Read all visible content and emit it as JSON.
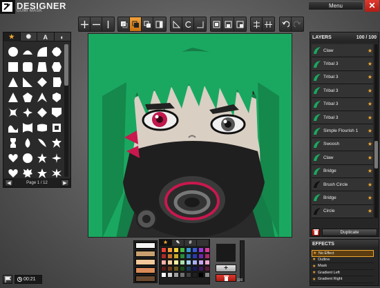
{
  "app": {
    "title": "DESIGNER",
    "subtitle": "GUMI MASK",
    "menu_label": "Menu",
    "close_label": "✕"
  },
  "toolbar": {
    "groups": [
      [
        "move-icon",
        "resize-horizontal-icon",
        "resize-vertical-icon"
      ],
      [
        "bring-front-icon",
        "stack-order-icon",
        "send-backward-icon",
        "send-back-icon"
      ],
      [
        "flip-horizontal-icon",
        "rotate-icon",
        "flip-vertical-icon"
      ],
      [
        "align-left-icon",
        "align-center-icon",
        "align-right-icon"
      ],
      [
        "center-horizontal-icon",
        "center-vertical-icon"
      ],
      [
        "undo-icon",
        "redo-icon"
      ]
    ]
  },
  "shapes": {
    "tabs": [
      "★",
      "✺",
      "A",
      "◐"
    ],
    "page_label": "Page 1 / 12",
    "prev_label": "◀",
    "next_label": "▶"
  },
  "layers": {
    "title": "LAYERS",
    "count": "100 / 100",
    "items": [
      {
        "name": "Claw",
        "color": "#1aa860"
      },
      {
        "name": "Tribal 3",
        "color": "#1aa860"
      },
      {
        "name": "Tribal 3",
        "color": "#1aa860"
      },
      {
        "name": "Tribal 3",
        "color": "#1aa860"
      },
      {
        "name": "Tribal 3",
        "color": "#1aa860"
      },
      {
        "name": "Tribal 3",
        "color": "#1aa860"
      },
      {
        "name": "Simple Flourish 1",
        "color": "#1aa860"
      },
      {
        "name": "Swoosh",
        "color": "#1aa860"
      },
      {
        "name": "Claw",
        "color": "#1aa860"
      },
      {
        "name": "Bridge",
        "color": "#1aa860"
      },
      {
        "name": "Brush Circle",
        "color": "#111111"
      },
      {
        "name": "Bridge",
        "color": "#1aa860"
      },
      {
        "name": "Circle",
        "color": "#111111"
      }
    ],
    "duplicate_label": "Duplicate"
  },
  "effects": {
    "title": "EFFECTS",
    "items": [
      "No Effect",
      "Outline",
      "Mask",
      "Gradient Left",
      "Gradient Right"
    ]
  },
  "colours": {
    "tabs": [
      "★",
      "✎",
      "#",
      ""
    ],
    "opacity_label": "100",
    "add_label": "+",
    "swatch_bars": [
      "#f5f5f5",
      "#c8a070",
      "#f3c89a",
      "#d98b5a",
      "#6a4a30"
    ],
    "palette": [
      "#e8413a",
      "#f39c3a",
      "#f5d33a",
      "#4aba4a",
      "#3a9ad9",
      "#3a5ad9",
      "#9a3ad9",
      "#d93a9a",
      "#a82a2a",
      "#c8702a",
      "#c8a82a",
      "#2a8a3a",
      "#2a6aa8",
      "#2a3aa8",
      "#6a2aa8",
      "#a82a6a",
      "#f7b0a8",
      "#f7d0a0",
      "#f7f0a0",
      "#a8e0a8",
      "#a8d0f0",
      "#a8b0f0",
      "#c8a8f0",
      "#f0a8d0",
      "#5a1a1a",
      "#6a3a1a",
      "#6a5a1a",
      "#1a4a1a",
      "#1a3a5a",
      "#1a1a5a",
      "#3a1a5a",
      "#5a1a3a",
      "#ffffff",
      "#d0d0d0",
      "#a0a0a0",
      "#707070",
      "#404040",
      "#202020",
      "#000000",
      "#888888"
    ]
  },
  "timer": {
    "value": "00:21"
  },
  "accent_color": "#f3a833"
}
